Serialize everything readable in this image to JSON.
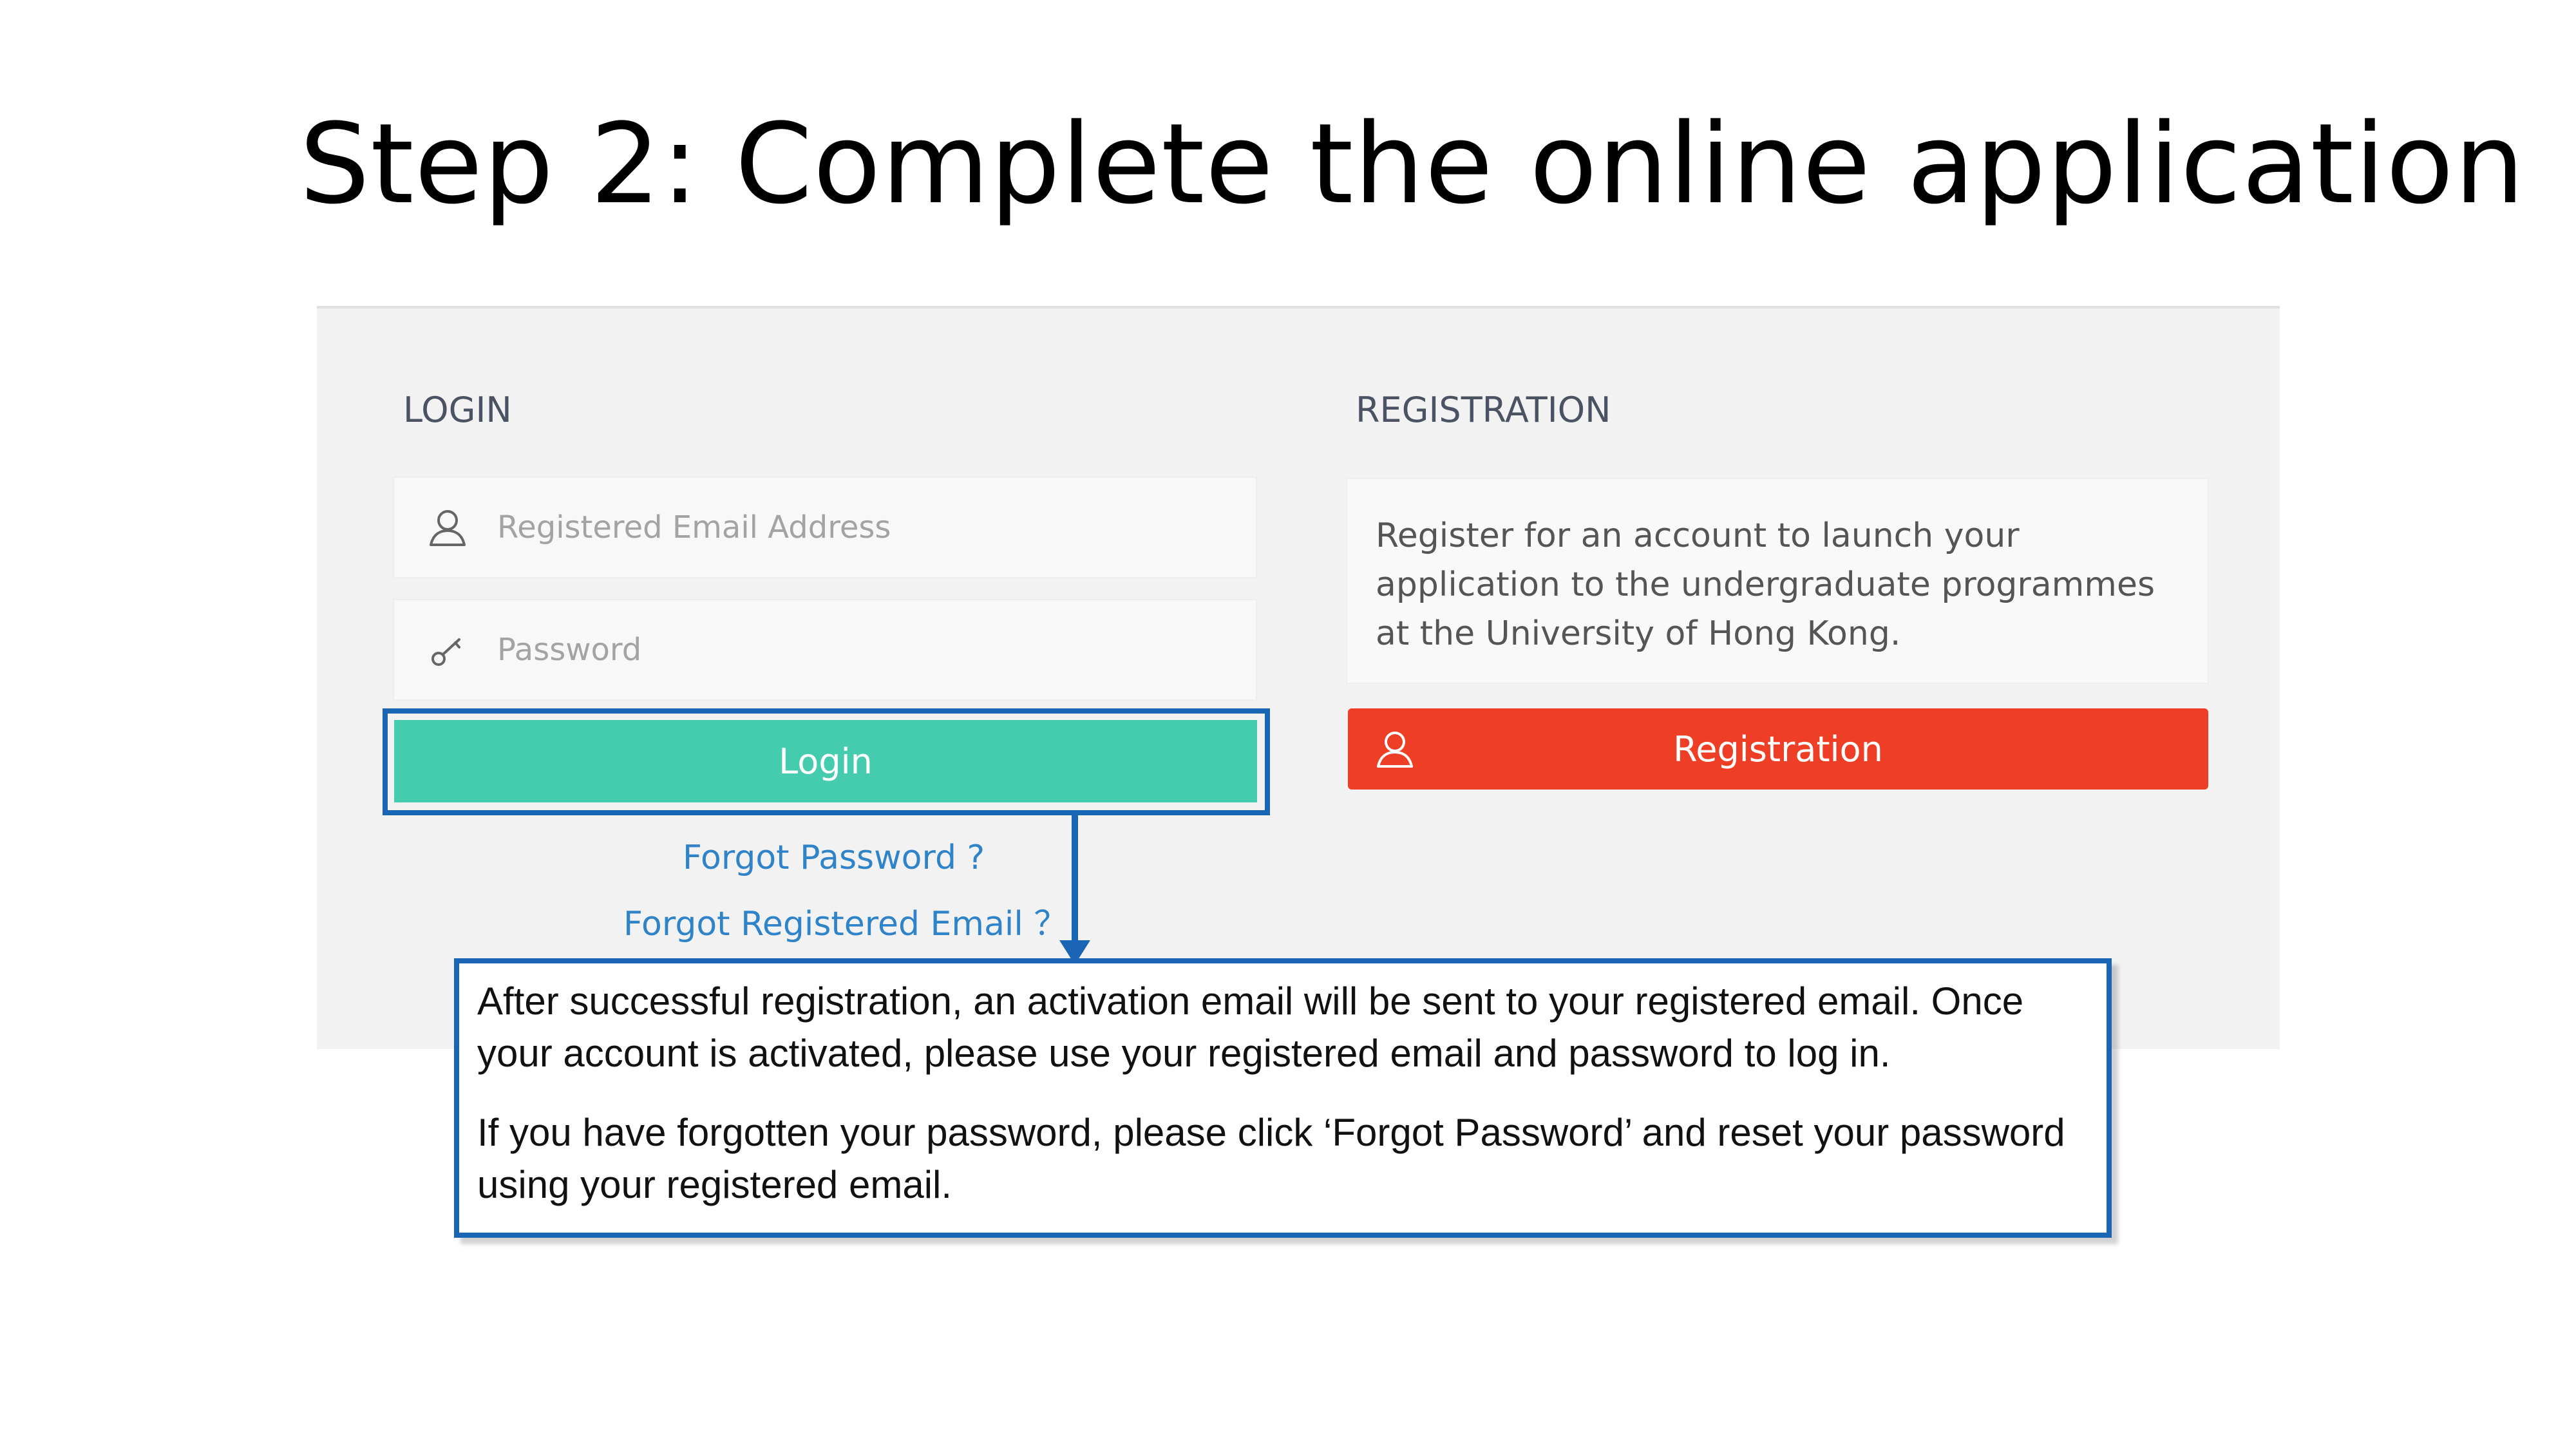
{
  "slide": {
    "title": "Step 2: Complete the online application"
  },
  "login": {
    "heading": "LOGIN",
    "email_placeholder": "Registered Email Address",
    "email_icon": "user-icon",
    "password_placeholder": "Password",
    "password_icon": "key-icon",
    "login_button": "Login",
    "forgot_password_link": "Forgot Password ?",
    "forgot_email_link": "Forgot Registered Email ？"
  },
  "registration": {
    "heading": "REGISTRATION",
    "description": "Register for an account to launch your application to the undergraduate programmes at the University of Hong Kong.",
    "button": "Registration",
    "button_icon": "user-icon"
  },
  "callout": {
    "paragraph_1": "After successful registration, an activation email will be sent to your registered email. Once your account is activated, please use your registered email and password to log in.",
    "paragraph_2": "If you have forgotten your password, please click ‘Forgot Password’ and reset your password using your registered email."
  },
  "colors": {
    "login_button": "#45cbad",
    "registration_button": "#ee3f26",
    "highlight_border": "#1a66b5",
    "link": "#2f83c8",
    "panel_background": "#f2f2f2"
  }
}
